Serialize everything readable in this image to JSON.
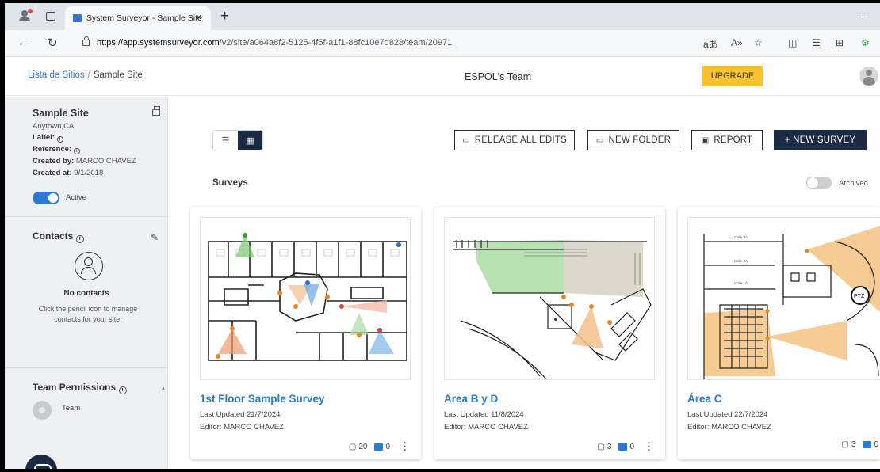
{
  "browser": {
    "tab_title": "System Surveyor - Sample Site",
    "tab_close": "×",
    "new_tab": "+",
    "minimize": "–",
    "url_host": "https://app.systemsurveyor.com",
    "url_path": "/v2/site/a064a8f2-5125-4f5f-a1f1-88fc10e7d828/team/20971",
    "toolbar": [
      "aあ",
      "A»",
      "☆",
      "◫",
      "☰",
      "⊞",
      "⚙"
    ]
  },
  "header": {
    "breadcrumb_root": "Lista de Sitios",
    "breadcrumb_sep": "/",
    "breadcrumb_current": "Sample Site",
    "team_name": "ESPOL's Team",
    "upgrade_label": "UPGRADE"
  },
  "sidebar": {
    "site": {
      "title": "Sample Site",
      "location": "Anytown,CA",
      "label_key": "Label:",
      "reference_key": "Reference:",
      "created_by_key": "Created by:",
      "created_by": "MARCO CHAVEZ",
      "created_at_key": "Created at:",
      "created_at": "9/1/2018",
      "active_label": "Active"
    },
    "contacts": {
      "heading": "Contacts",
      "empty_title": "No contacts",
      "empty_hint": "Click the pencil icon to manage contacts for your site."
    },
    "permissions": {
      "heading": "Team Permissions",
      "team_label": "Team"
    }
  },
  "main": {
    "actions": {
      "release": "RELEASE ALL EDITS",
      "new_folder": "NEW FOLDER",
      "report": "REPORT",
      "new_survey": "+ NEW SURVEY"
    },
    "surveys_label": "Surveys",
    "archived_label": "Archived",
    "cards": [
      {
        "title": "1st Floor Sample Survey",
        "updated": "Last Updated 21/7/2024",
        "editor": "Editor: MARCO CHAVEZ",
        "pages": "20",
        "comments": "0"
      },
      {
        "title": "Area B y D",
        "updated": "Last Updated 11/8/2024",
        "editor": "Editor: MARCO CHAVEZ",
        "pages": "3",
        "comments": "0"
      },
      {
        "title": "Área C",
        "updated": "Last Updated 22/7/2024",
        "editor": "Editor: MARCO CHAVEZ",
        "pages": "3",
        "comments": "0"
      }
    ]
  },
  "colors": {
    "accent": "#2b7bd0",
    "navy": "#1c2a44",
    "upgrade": "#f7c22e"
  }
}
